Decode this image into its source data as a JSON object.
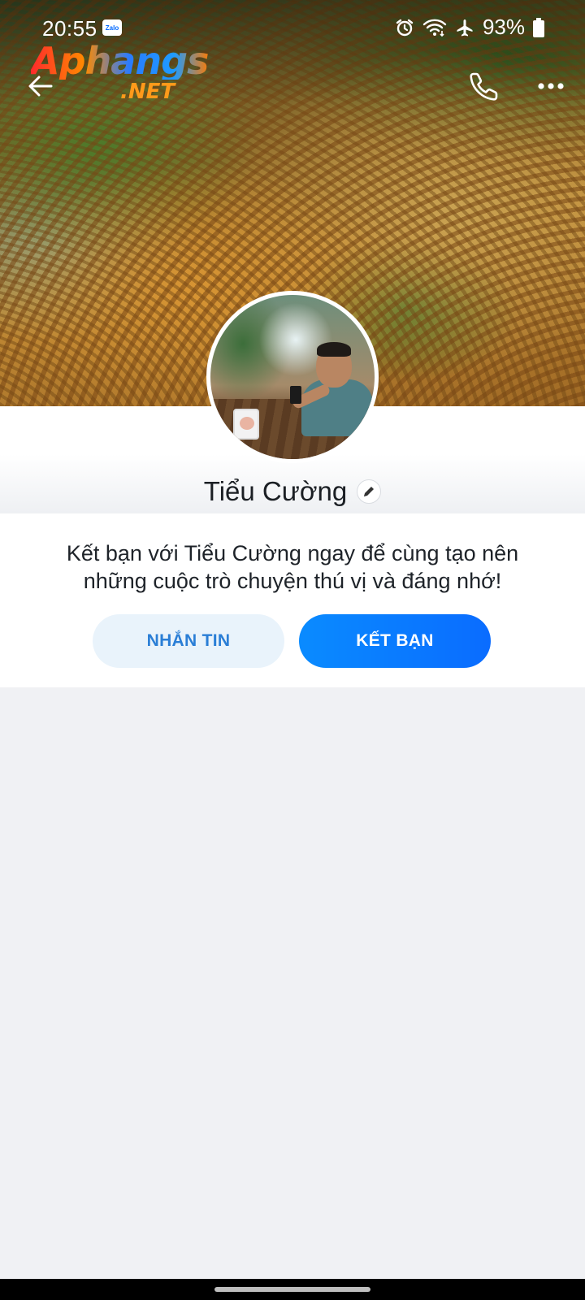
{
  "status_bar": {
    "time": "20:55",
    "notification_app": "Zalo",
    "battery": "93%",
    "icons": [
      "alarm-icon",
      "wifi-icon",
      "airplane-mode-icon",
      "battery-icon"
    ]
  },
  "watermark": {
    "main": "Aphangs",
    "sub": ".NET"
  },
  "toolbar": {
    "back_icon": "back-arrow-icon",
    "call_icon": "phone-icon",
    "more_icon": "more-dots-icon"
  },
  "profile": {
    "name": "Tiểu Cường",
    "edit_icon": "pencil-icon"
  },
  "invite": {
    "message": "Kết bạn với Tiểu Cường ngay để cùng tạo nên những cuộc trò chuyện thú vị và đáng nhớ!",
    "message_button": "NHẮN TIN",
    "add_friend_button": "KẾT BẠN"
  },
  "colors": {
    "accent": "#0a7bff",
    "message_button_bg": "#e9f3fb",
    "message_button_text": "#2a7ed6",
    "page_bg": "#f0f1f4"
  }
}
